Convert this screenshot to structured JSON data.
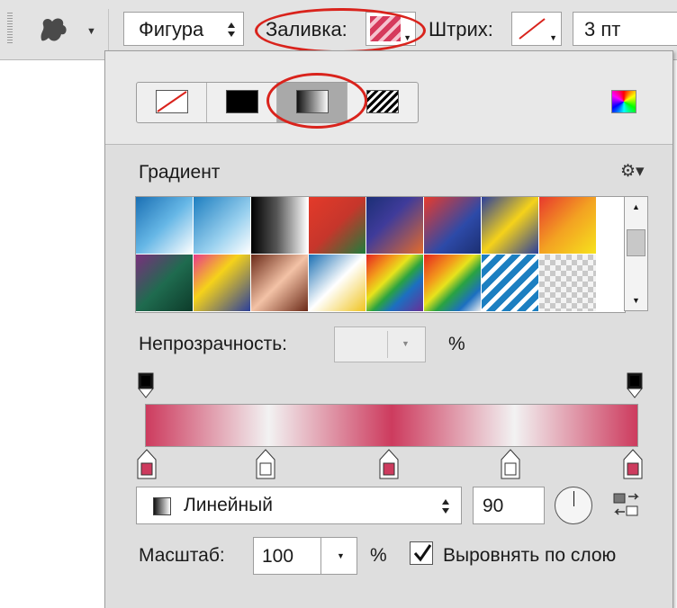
{
  "toolbar": {
    "shape_type": "Фигура",
    "fill_label": "Заливка:",
    "stroke_label": "Штрих:",
    "stroke_width": "3 пт"
  },
  "fill_panel": {
    "fill_types": [
      "no-fill",
      "solid-color",
      "gradient",
      "pattern"
    ],
    "selected_fill_type": "gradient",
    "gradient_title": "Градиент",
    "opacity_label": "Непрозрачность:",
    "opacity_value": "",
    "opacity_unit": "%",
    "gradient_type": "Линейный",
    "angle": "90",
    "scale_label": "Масштаб:",
    "scale_value": "100",
    "scale_unit": "%",
    "align_with_layer_label": "Выровнять по слою",
    "align_with_layer_checked": true,
    "presets": [
      "linear-gradient(135deg,#1a6fb3 0%,#66b7e6 50%,#ffffff 100%)",
      "linear-gradient(135deg,#1d7ec0 0%,#9ad1ef 60%,#ffffff 100%)",
      "linear-gradient(90deg,#000 0%,#555 45%,#fff 100%)",
      "linear-gradient(135deg,#e43a2a 0%,#c6362b 50%,#1e7d3c 100%)",
      "linear-gradient(135deg,#1b2f75 0%,#3f3b9a 40%,#e46b2b 100%)",
      "linear-gradient(135deg,#e83a2c 0%,#2d4aa8 60%,#1c2f72 100%)",
      "linear-gradient(135deg,#2b3f9c 0%,#f5d21a 50%,#2b3f9c 100%)",
      "linear-gradient(135deg,#e8382d 0%,#f3a222 50%,#f6e21d 100%)",
      "linear-gradient(135deg,#7a2f7d 0%,#1f6b4f 50%,#0d3b2a 100%)",
      "linear-gradient(135deg,#e93a8a 0%,#f5d21a 40%,#2b3f9c 100%)",
      "linear-gradient(135deg,#6b2a18 0%,#f3c2a6 50%,#6b2a18 100%)",
      "linear-gradient(135deg,#1a6fb3 0%,#ffffff 50%,#f0c420 100%)",
      "linear-gradient(135deg,#e52420 0%,#f39a1c 25%,#e8e31c 40%,#2aa341 55%,#1c6fc1 70%,#6a2f96 100%)",
      "linear-gradient(135deg,#e52420 0%,#f39a1c 30%,#e8e31c 45%,#2aa341 60%,#1c6fc1 80%,#f0f0f0 100%)",
      "repeating-linear-gradient(135deg,#1c7fc1 0 7px,#ffffff 7px 12px)",
      "repeating-conic-gradient(#c9c9c9 0 25%,#f4f4f4 0 50%) 0 0/12px 12px"
    ],
    "stops_opacity": [
      "#000000",
      "#000000"
    ],
    "stops_color": [
      "#cd3b5e",
      "#ffffff",
      "#cd3b5e",
      "#ffffff",
      "#cd3b5e"
    ]
  }
}
